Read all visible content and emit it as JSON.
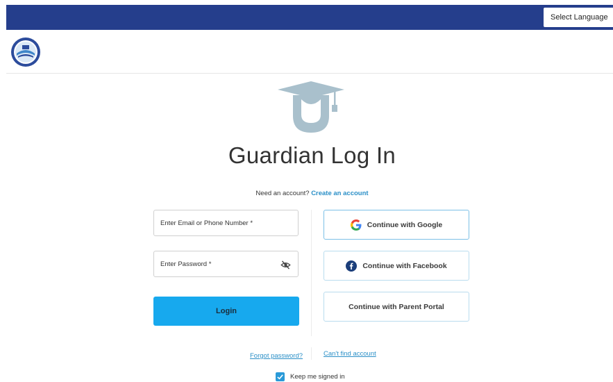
{
  "translate": {
    "label": "Select Language",
    "arrow": "▼"
  },
  "header": {
    "logo_icon": "school-district-seal-icon"
  },
  "hero": {
    "icon": "graduate-cap-person-icon"
  },
  "login": {
    "title": "Guardian Log In",
    "need_account_text": "Need an account?",
    "create_account_link": "Create an account",
    "email_label": "Enter Email or Phone Number *",
    "password_label": "Enter Password *",
    "login_button": "Login",
    "forgot_password": "Forgot password?",
    "keep_signed_in": "Keep me signed in",
    "keep_signed_in_checked": true
  },
  "sso": {
    "google": "Continue with Google",
    "facebook": "Continue with Facebook",
    "parent_portal": "Continue with Parent Portal",
    "cant_find": "Can't find account"
  },
  "colors": {
    "topbar": "#253e8c",
    "primary_button": "#17a9ee",
    "link": "#2a8fc7",
    "hero_icon": "#a9c0cc"
  }
}
